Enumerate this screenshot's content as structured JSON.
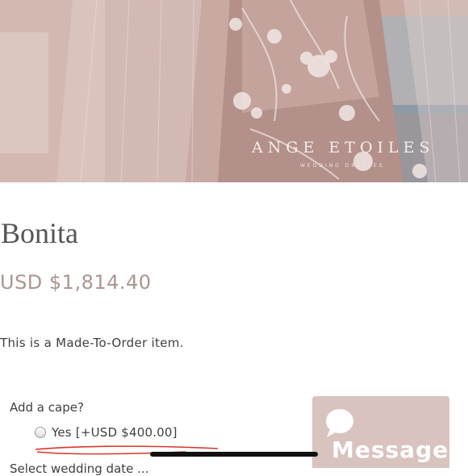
{
  "hero": {
    "brand": "ANGE ETOILES",
    "brand_sub": "WEDDING DRESSES"
  },
  "product": {
    "title": "Bonita",
    "price": "USD $1,814.40",
    "note": "This is a Made-To-Order item."
  },
  "options": {
    "cape_label": "Add a cape?",
    "cape_yes": "Yes [+USD $400.00]",
    "next_label": "Select wedding date ..."
  },
  "chat": {
    "label": "Message",
    "icon": "chat-bubble-icon",
    "color": "#d9c3bf"
  },
  "colors": {
    "price": "#a99591",
    "annotation": "#d9362b"
  }
}
